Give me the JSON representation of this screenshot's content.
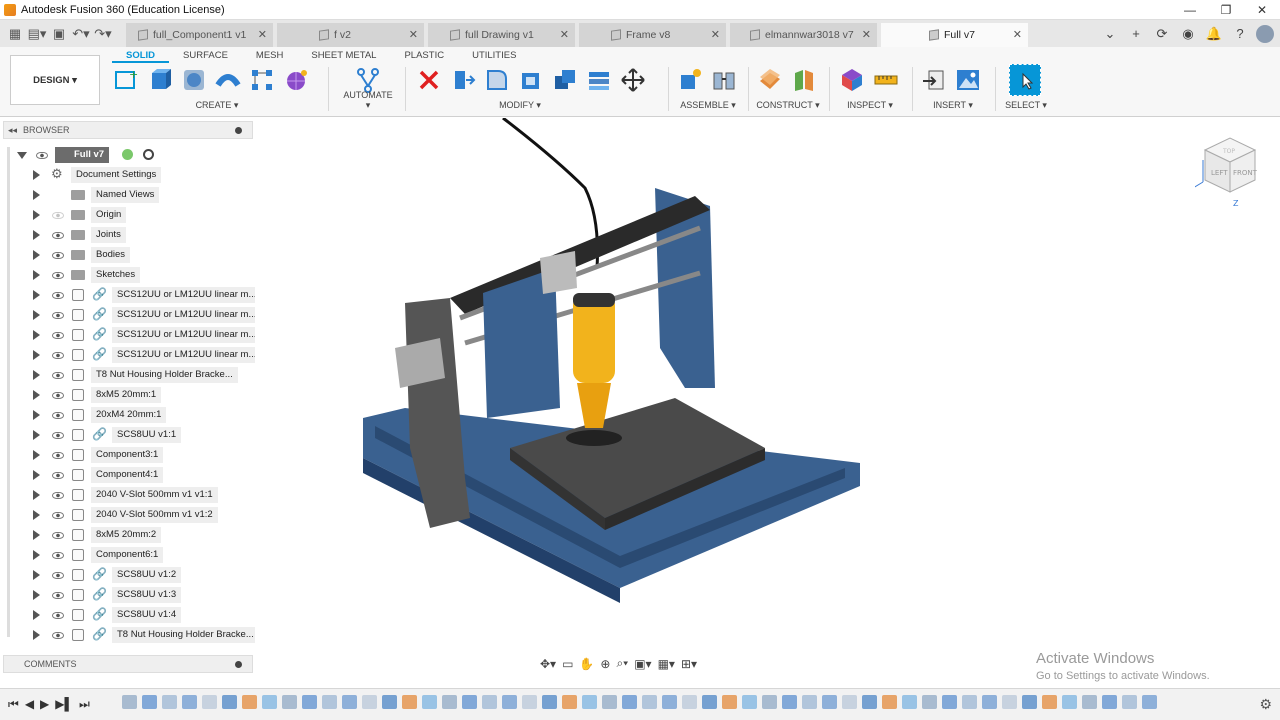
{
  "window": {
    "title": "Autodesk Fusion 360 (Education License)"
  },
  "tabs": [
    {
      "label": "full_Component1 v1",
      "active": false
    },
    {
      "label": "f v2",
      "active": false
    },
    {
      "label": "full Drawing v1",
      "active": false
    },
    {
      "label": "Frame v8",
      "active": false
    },
    {
      "label": "elmannwar3018 v7",
      "active": false
    },
    {
      "label": "Full v7",
      "active": true
    }
  ],
  "ribbon": {
    "workspace": "DESIGN ▾",
    "tabs": [
      "SOLID",
      "SURFACE",
      "MESH",
      "SHEET METAL",
      "PLASTIC",
      "UTILITIES"
    ],
    "groups": {
      "create": "CREATE ▾",
      "automate": "AUTOMATE ▾",
      "modify": "MODIFY ▾",
      "assemble": "ASSEMBLE ▾",
      "construct": "CONSTRUCT ▾",
      "inspect": "INSPECT ▾",
      "insert": "INSERT ▾",
      "select": "SELECT ▾"
    }
  },
  "browser": {
    "title": "BROWSER",
    "root": "Full v7",
    "items": [
      {
        "label": "Document Settings",
        "kind": "settings"
      },
      {
        "label": "Named Views",
        "kind": "folder"
      },
      {
        "label": "Origin",
        "kind": "folder"
      },
      {
        "label": "Joints",
        "kind": "folder"
      },
      {
        "label": "Bodies",
        "kind": "folder"
      },
      {
        "label": "Sketches",
        "kind": "folder"
      },
      {
        "label": "SCS12UU or LM12UU linear m...",
        "kind": "link"
      },
      {
        "label": "SCS12UU or LM12UU linear m...",
        "kind": "link"
      },
      {
        "label": "SCS12UU or LM12UU linear m...",
        "kind": "link"
      },
      {
        "label": "SCS12UU or LM12UU linear m...",
        "kind": "link"
      },
      {
        "label": "T8 Nut Housing Holder Bracke...",
        "kind": "comp"
      },
      {
        "label": "8xM5 20mm:1",
        "kind": "comp"
      },
      {
        "label": "20xM4 20mm:1",
        "kind": "comp"
      },
      {
        "label": "SCS8UU v1:1",
        "kind": "link"
      },
      {
        "label": "Component3:1",
        "kind": "comp"
      },
      {
        "label": "Component4:1",
        "kind": "comp"
      },
      {
        "label": "2040 V-Slot 500mm v1 v1:1",
        "kind": "comp"
      },
      {
        "label": "2040 V-Slot 500mm v1 v1:2",
        "kind": "comp"
      },
      {
        "label": "8xM5 20mm:2",
        "kind": "comp"
      },
      {
        "label": "Component6:1",
        "kind": "comp"
      },
      {
        "label": "SCS8UU v1:2",
        "kind": "link"
      },
      {
        "label": "SCS8UU v1:3",
        "kind": "link"
      },
      {
        "label": "SCS8UU v1:4",
        "kind": "link"
      },
      {
        "label": "T8 Nut Housing Holder Bracke...",
        "kind": "link"
      }
    ]
  },
  "comments": {
    "title": "COMMENTS"
  },
  "viewcube": {
    "left": "LEFT",
    "front": "FRONT",
    "top": "TOP",
    "axis": "Z"
  },
  "watermark": {
    "line1": "Activate Windows",
    "line2": "Go to Settings to activate Windows."
  },
  "colors": {
    "accent": "#0696d7",
    "frame_blue": "#3a6190",
    "spindle_yellow": "#f2b31c"
  }
}
